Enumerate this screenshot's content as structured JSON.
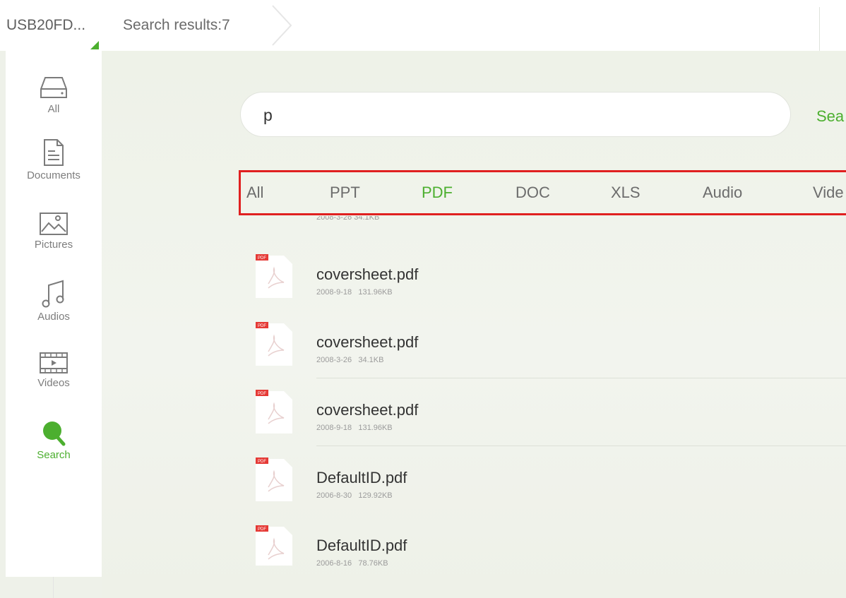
{
  "breadcrumb": {
    "device": "USB20FD...",
    "results": "Search results:7"
  },
  "sidebar": {
    "items": [
      {
        "label": "All",
        "icon": "drive-icon",
        "active": false
      },
      {
        "label": "Documents",
        "icon": "document-icon",
        "active": false
      },
      {
        "label": "Pictures",
        "icon": "picture-icon",
        "active": false
      },
      {
        "label": "Audios",
        "icon": "music-note-icon",
        "active": false
      },
      {
        "label": "Videos",
        "icon": "video-icon",
        "active": false
      },
      {
        "label": "Search",
        "icon": "search-icon",
        "active": true
      }
    ]
  },
  "search": {
    "value": "p",
    "button_label": "Sea"
  },
  "filters": {
    "tabs": [
      "All",
      "PPT",
      "PDF",
      "DOC",
      "XLS",
      "Audio",
      "Vide"
    ],
    "selected": "PDF"
  },
  "files": {
    "partial_meta": "2008-3-26   34.1KB",
    "rows": [
      {
        "name": "coversheet.pdf",
        "date": "2008-9-18",
        "size": "131.96KB"
      },
      {
        "name": "coversheet.pdf",
        "date": "2008-3-26",
        "size": "34.1KB"
      },
      {
        "name": "coversheet.pdf",
        "date": "2008-9-18",
        "size": "131.96KB"
      },
      {
        "name": "DefaultID.pdf",
        "date": "2006-8-30",
        "size": "129.92KB"
      },
      {
        "name": "DefaultID.pdf",
        "date": "2006-8-16",
        "size": "78.76KB"
      }
    ]
  },
  "colors": {
    "accent": "#4caf2f",
    "highlight_border": "#e02020",
    "pdf_badge": "#e53935"
  }
}
